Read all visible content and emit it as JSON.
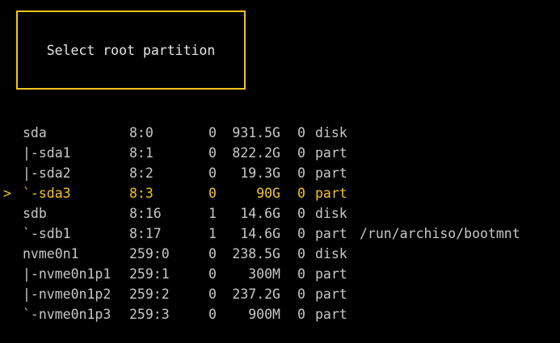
{
  "title": "Select root partition",
  "cursor_glyph": ">",
  "accent_color": "#f5c518",
  "selected_index": 3,
  "partitions": [
    {
      "name": "sda",
      "majmin": "8:0",
      "rm": "0",
      "size": "931.5G",
      "ro": "0",
      "type": "disk",
      "mount": ""
    },
    {
      "name": "|-sda1",
      "majmin": "8:1",
      "rm": "0",
      "size": "822.2G",
      "ro": "0",
      "type": "part",
      "mount": ""
    },
    {
      "name": "|-sda2",
      "majmin": "8:2",
      "rm": "0",
      "size": "19.3G",
      "ro": "0",
      "type": "part",
      "mount": ""
    },
    {
      "name": "`-sda3",
      "majmin": "8:3",
      "rm": "0",
      "size": "90G",
      "ro": "0",
      "type": "part",
      "mount": ""
    },
    {
      "name": "sdb",
      "majmin": "8:16",
      "rm": "1",
      "size": "14.6G",
      "ro": "0",
      "type": "disk",
      "mount": ""
    },
    {
      "name": "`-sdb1",
      "majmin": "8:17",
      "rm": "1",
      "size": "14.6G",
      "ro": "0",
      "type": "part",
      "mount": "/run/archiso/bootmnt"
    },
    {
      "name": "nvme0n1",
      "majmin": "259:0",
      "rm": "0",
      "size": "238.5G",
      "ro": "0",
      "type": "disk",
      "mount": ""
    },
    {
      "name": "|-nvme0n1p1",
      "majmin": "259:1",
      "rm": "0",
      "size": "300M",
      "ro": "0",
      "type": "part",
      "mount": ""
    },
    {
      "name": "|-nvme0n1p2",
      "majmin": "259:2",
      "rm": "0",
      "size": "237.2G",
      "ro": "0",
      "type": "part",
      "mount": ""
    },
    {
      "name": "`-nvme0n1p3",
      "majmin": "259:3",
      "rm": "0",
      "size": "900M",
      "ro": "0",
      "type": "part",
      "mount": ""
    }
  ]
}
